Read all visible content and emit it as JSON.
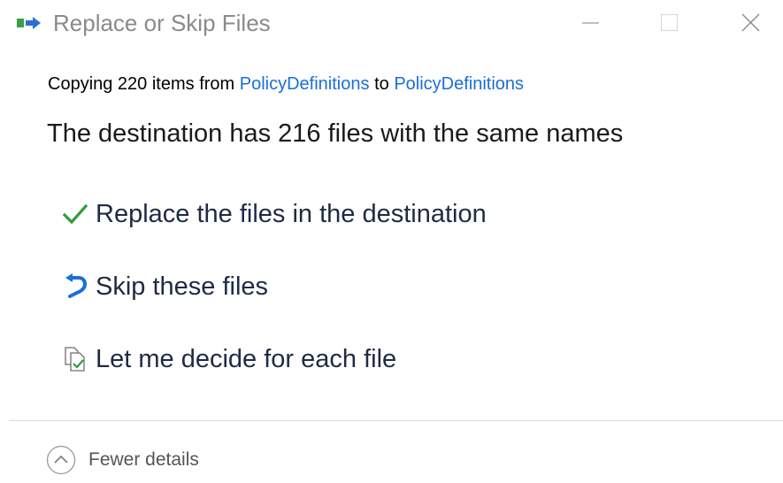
{
  "window": {
    "title": "Replace or Skip Files"
  },
  "copying": {
    "prefix": "Copying 220 items from",
    "source": "PolicyDefinitions",
    "middle": "to",
    "destination": "PolicyDefinitions"
  },
  "headline": "The destination has 216 files with the same names",
  "options": [
    {
      "label": "Replace the files in the destination",
      "icon": "checkmark-icon",
      "color": "#2e9e3e"
    },
    {
      "label": "Skip these files",
      "icon": "skip-arrow-icon",
      "color": "#1a6fd8"
    },
    {
      "label": "Let me decide for each file",
      "icon": "compare-files-icon"
    }
  ],
  "details": {
    "label": "Fewer details",
    "icon": "chevron-up-circle-icon"
  },
  "colors": {
    "link": "#1a6fd8",
    "title_text": "#8a8a8a",
    "option_text": "#1f2a44"
  }
}
